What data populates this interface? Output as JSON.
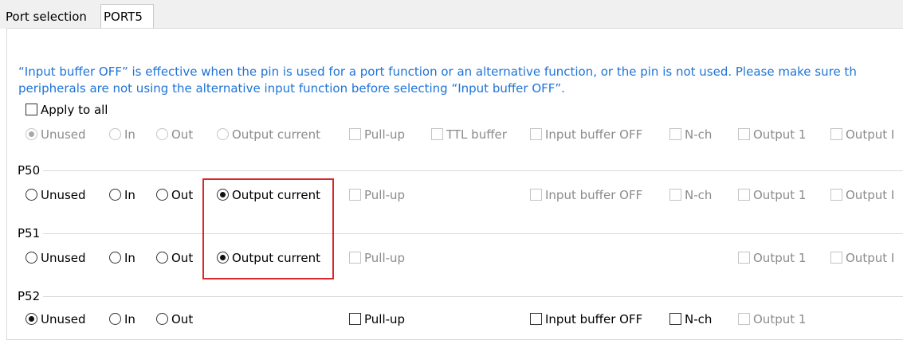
{
  "tabs": [
    {
      "label": "Port selection"
    },
    {
      "label": "PORT5"
    }
  ],
  "info": {
    "line1": "“Input buffer OFF” is effective when the pin is used for a port function or an alternative function, or the pin is not used. Please make sure th",
    "line2": "peripherals are not using the alternative input function before selecting “Input buffer OFF”."
  },
  "apply_all": {
    "label": "Apply to all",
    "checked": false
  },
  "labels": {
    "unused": "Unused",
    "in": "In",
    "out": "Out",
    "output_current": "Output current",
    "pull_up": "Pull-up",
    "ttl_buffer": "TTL buffer",
    "input_buffer_off": "Input buffer OFF",
    "n_ch": "N-ch",
    "output_1": "Output 1",
    "output_partial": "Output I"
  },
  "pins": [
    {
      "name": "P50",
      "selected": "output_current"
    },
    {
      "name": "P51",
      "selected": "output_current"
    },
    {
      "name": "P52",
      "selected": "unused"
    }
  ],
  "colors": {
    "info_text": "#1e73d8",
    "highlight": "#d9282b"
  }
}
